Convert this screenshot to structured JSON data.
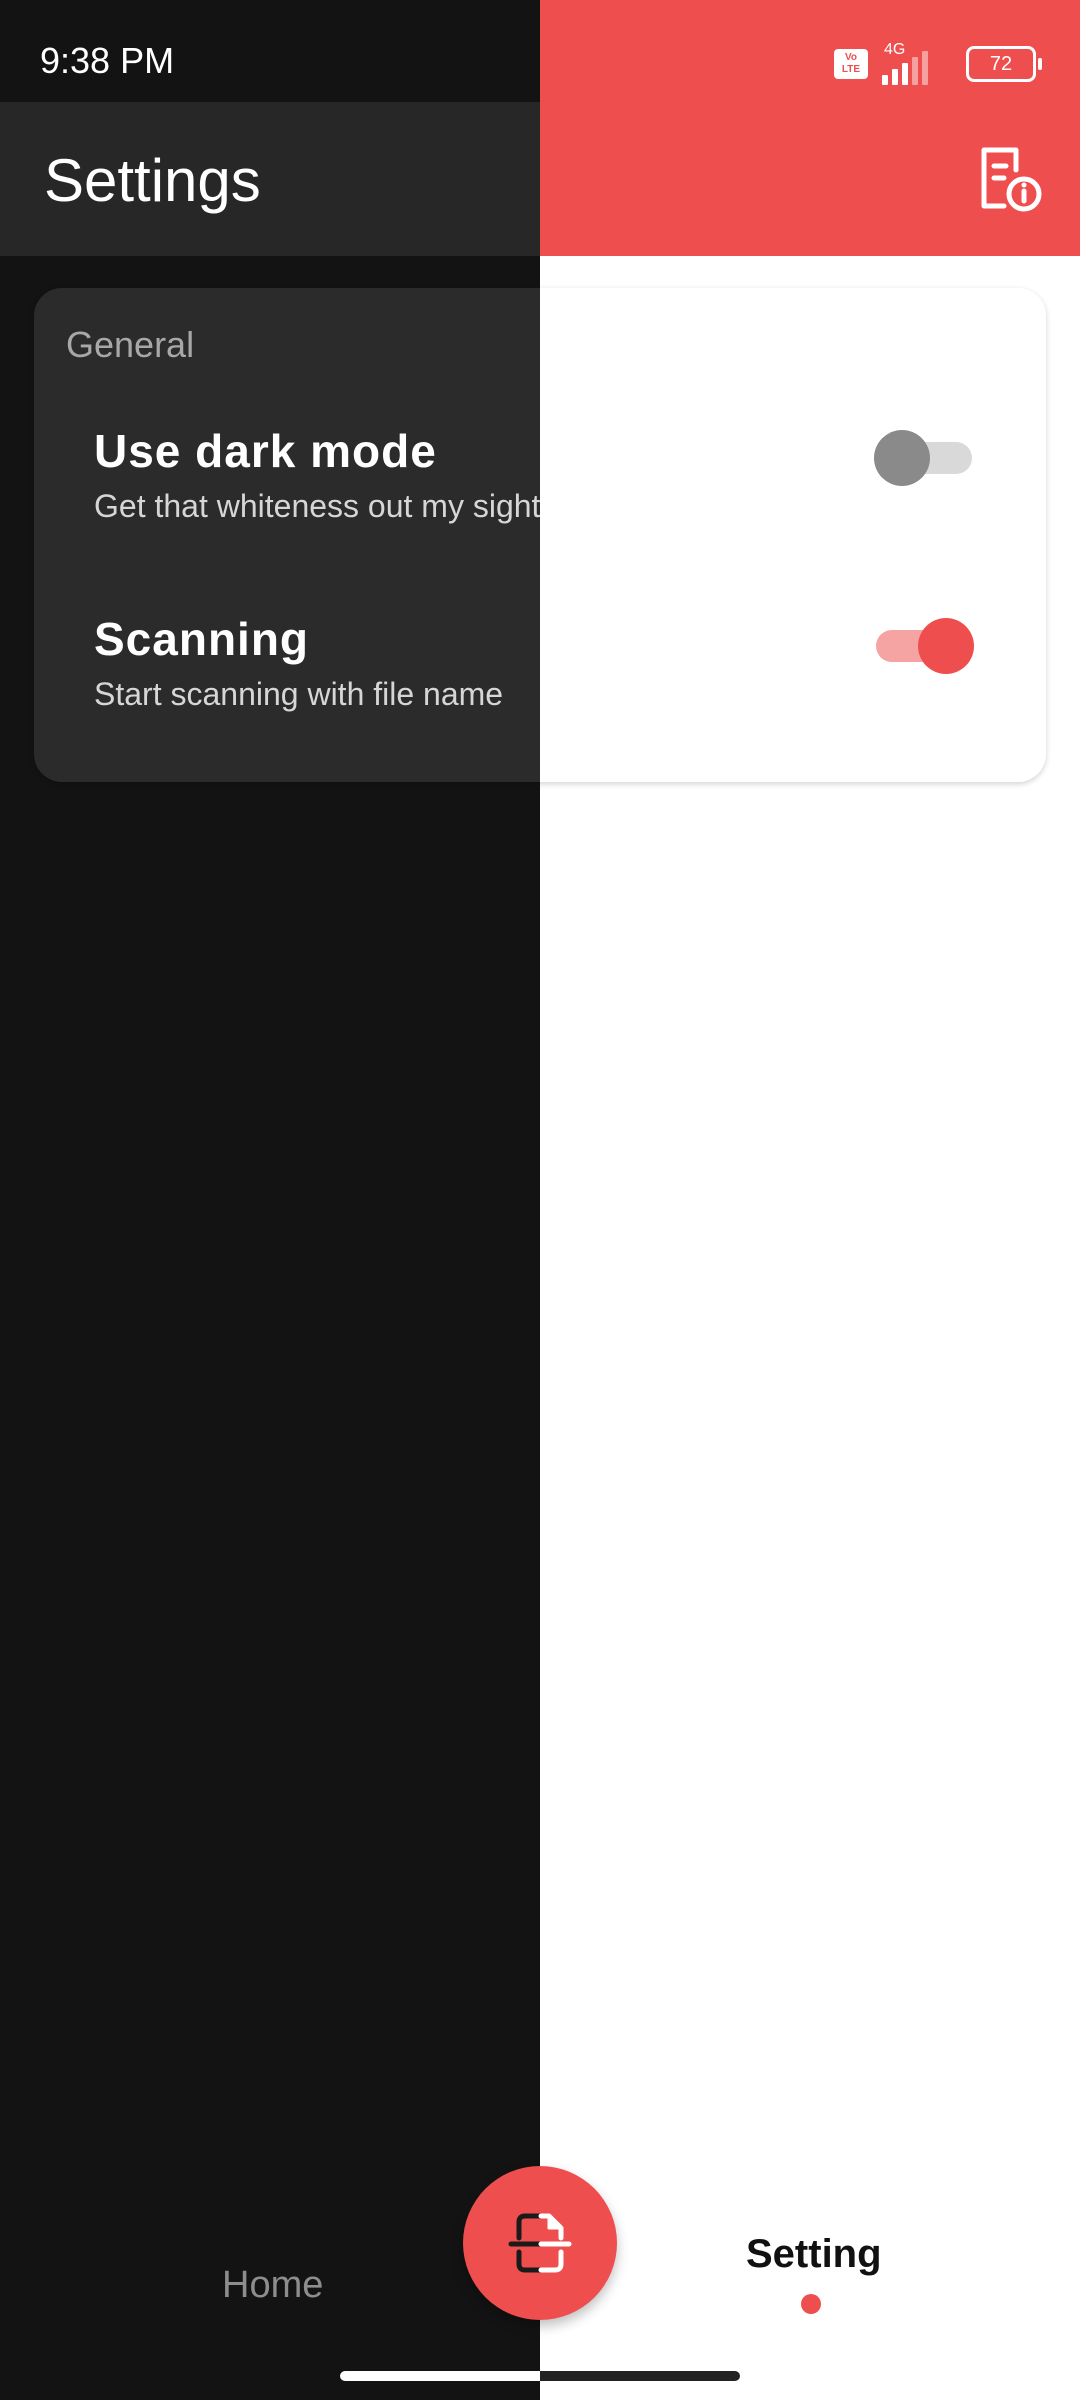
{
  "status_bar": {
    "time": "9:38 PM",
    "volte_label": "Vo\nLTE",
    "network": "4G",
    "battery": "72",
    "signal_icon": "signal-icon"
  },
  "app_bar": {
    "title": "Settings",
    "action_icon": "document-info-icon"
  },
  "settings": {
    "section": "General",
    "items": [
      {
        "title": "Use dark mode",
        "subtitle": "Get that whiteness out my sight",
        "enabled": false
      },
      {
        "title": "Scanning",
        "subtitle": "Start scanning with file name",
        "enabled": true
      }
    ]
  },
  "bottom_nav": {
    "home_label": "Home",
    "setting_label": "Setting",
    "fab_icon": "scan-document-icon",
    "active": "Setting"
  },
  "colors": {
    "accent": "#ef4e4e",
    "dark_bg": "#131313",
    "dark_surface": "#2b2b2b",
    "light_bg": "#ffffff"
  }
}
